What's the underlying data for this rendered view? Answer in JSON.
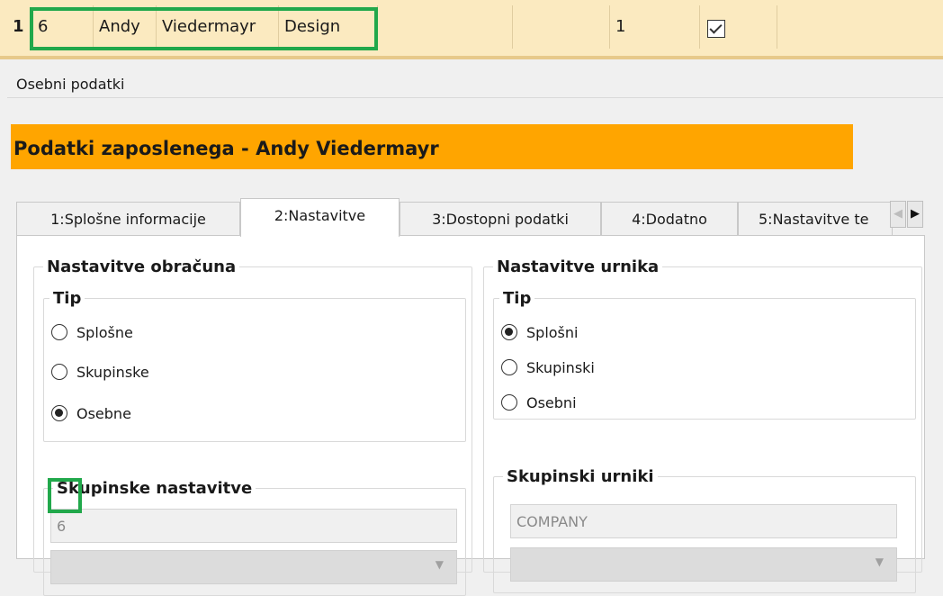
{
  "record_row": {
    "row_number": "1",
    "cells": [
      "6",
      "Andy",
      "Viedermayr",
      "Design",
      "",
      "1"
    ],
    "checked": true
  },
  "section_label": "Osebni podatki",
  "banner_title": "Podatki zaposlenega - Andy Viedermayr",
  "tabs": [
    {
      "label": "1:Splošne informacije",
      "active": false
    },
    {
      "label": "2:Nastavitve",
      "active": true
    },
    {
      "label": "3:Dostopni podatki",
      "active": false
    },
    {
      "label": "4:Dodatno",
      "active": false
    },
    {
      "label": "5:Nastavitve te",
      "active": false
    }
  ],
  "tab_arrows": {
    "left": "◀",
    "right": "▶"
  },
  "left_group": {
    "title": "Nastavitve obračuna",
    "type_title": "Tip",
    "options": [
      {
        "label": "Splošne",
        "selected": false
      },
      {
        "label": "Skupinske",
        "selected": false
      },
      {
        "label": "Osebne",
        "selected": true
      }
    ],
    "sub_title": "Skupinske nastavitve",
    "field_value": "6"
  },
  "right_group": {
    "title": "Nastavitve urnika",
    "type_title": "Tip",
    "options": [
      {
        "label": "Splošni",
        "selected": true
      },
      {
        "label": "Skupinski",
        "selected": false
      },
      {
        "label": "Osebni",
        "selected": false
      }
    ],
    "sub_title": "Skupinski urniki",
    "field_value": "COMPANY"
  },
  "colors": {
    "banner": "#ffa500",
    "row_bg": "#fbeac0",
    "highlight": "#21a84b"
  }
}
